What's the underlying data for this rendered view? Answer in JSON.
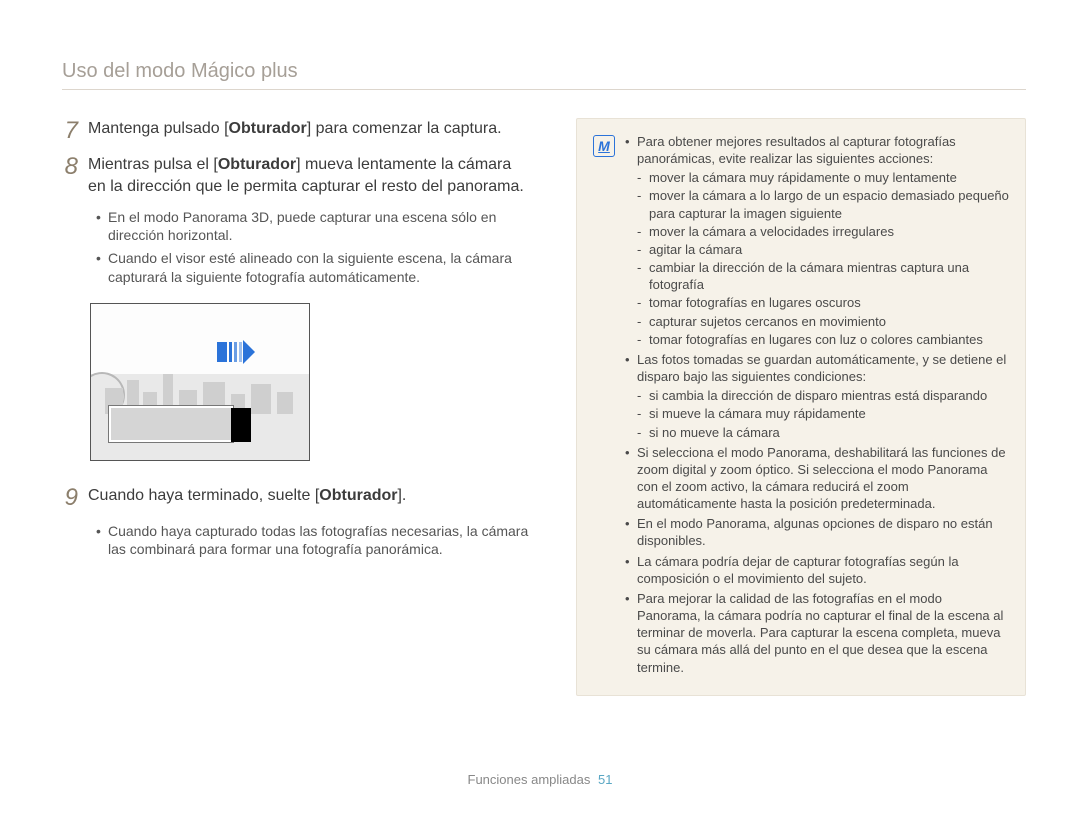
{
  "section_title": "Uso del modo Mágico plus",
  "steps": {
    "s7": {
      "num": "7",
      "text_before": "Mantenga pulsado [",
      "key": "Obturador",
      "text_after": "] para comenzar la captura."
    },
    "s8": {
      "num": "8",
      "text_before": "Mientras pulsa el [",
      "key": "Obturador",
      "text_after": "] mueva lentamente la cámara en la dirección que le permita capturar el resto del panorama.",
      "bullets": [
        "En el modo Panorama 3D, puede capturar una escena sólo en dirección horizontal.",
        "Cuando el visor esté alineado con la siguiente escena, la cámara capturará la siguiente fotografía automáticamente."
      ]
    },
    "s9": {
      "num": "9",
      "text_before": "Cuando haya terminado, suelte [",
      "key": "Obturador",
      "text_after": "].",
      "bullets": [
        "Cuando haya capturado todas las fotografías necesarias, la cámara las combinará para formar una fotografía panorámica."
      ]
    }
  },
  "note": {
    "icon_glyph": "M",
    "items": [
      {
        "text": "Para obtener mejores resultados al capturar fotografías panorámicas, evite realizar las siguientes acciones:",
        "dashes": [
          "mover la cámara muy rápidamente o muy lentamente",
          "mover la cámara a lo largo de un espacio demasiado pequeño para capturar la imagen siguiente",
          "mover la cámara a velocidades irregulares",
          "agitar la cámara",
          "cambiar la dirección de la cámara mientras captura una fotografía",
          "tomar fotografías en lugares oscuros",
          "capturar sujetos cercanos en movimiento",
          "tomar fotografías en lugares con luz o colores cambiantes"
        ]
      },
      {
        "text": "Las fotos tomadas se guardan automáticamente, y se detiene el disparo bajo las siguientes condiciones:",
        "dashes": [
          "si cambia la dirección de disparo mientras está disparando",
          "si mueve la cámara muy rápidamente",
          "si no mueve la cámara"
        ]
      },
      {
        "text": "Si selecciona el modo Panorama, deshabilitará las funciones de zoom digital y zoom óptico. Si selecciona el modo Panorama con el zoom activo, la cámara reducirá el zoom automáticamente hasta la posición predeterminada."
      },
      {
        "text": "En el modo Panorama, algunas opciones de disparo no están disponibles."
      },
      {
        "text": "La cámara podría dejar de capturar fotografías según la composición o el movimiento del sujeto."
      },
      {
        "text": "Para mejorar la calidad de las fotografías en el modo Panorama, la cámara podría no capturar el final de la escena al terminar de moverla. Para capturar la escena completa, mueva su cámara más allá del punto en el que desea que la escena termine."
      }
    ]
  },
  "footer": {
    "label": "Funciones ampliadas",
    "page": "51"
  }
}
